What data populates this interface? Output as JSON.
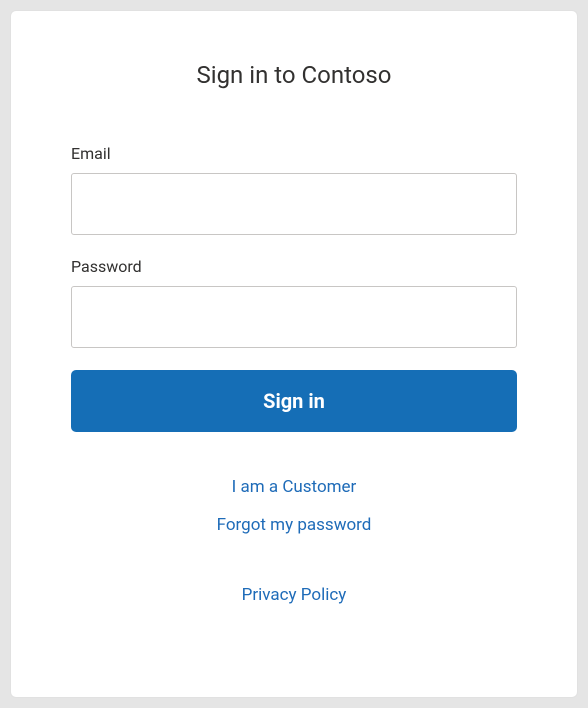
{
  "title": "Sign in to Contoso",
  "form": {
    "email_label": "Email",
    "email_value": "",
    "password_label": "Password",
    "password_value": "",
    "submit_label": "Sign in"
  },
  "links": {
    "customer": "I am a Customer",
    "forgot_password": "Forgot my password",
    "privacy": "Privacy Policy"
  },
  "colors": {
    "primary": "#156eb6",
    "link": "#1e6bb8",
    "text": "#323130",
    "border": "#c8c6c4"
  }
}
